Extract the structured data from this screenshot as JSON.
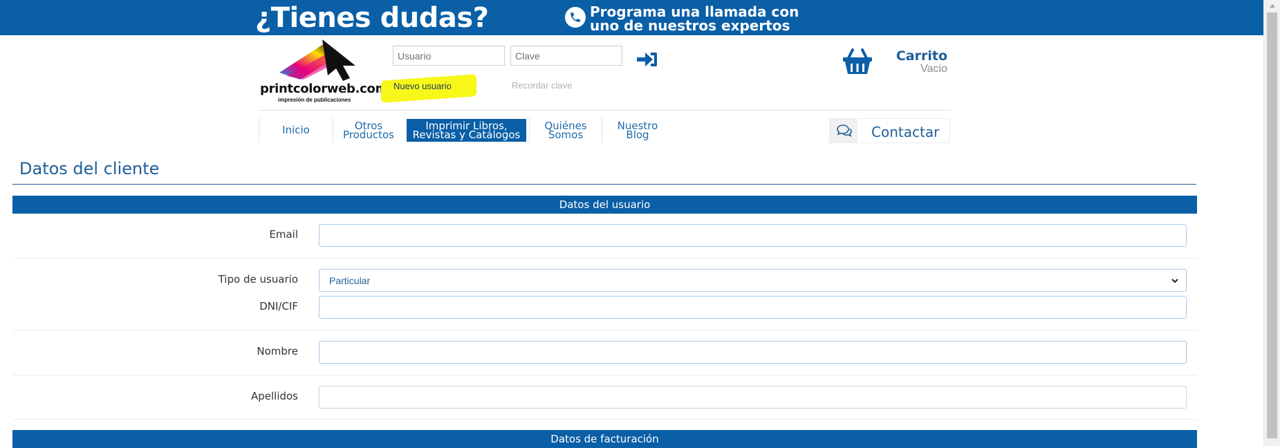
{
  "banner": {
    "question": "¿Tienes dudas?",
    "call_line1": "Programa una llamada con",
    "call_line2": "uno de nuestros expertos",
    "phone_icon": "phone-icon",
    "color": "#0a5fa6"
  },
  "header": {
    "logo_text": "printcolorweb.com",
    "logo_sub": "impresión de publicaciones",
    "user_placeholder": "Usuario",
    "pass_placeholder": "Clave",
    "login_icon": "sign-in-icon",
    "new_user": "Nuevo usuario",
    "remember": "Recordar clave",
    "cart": {
      "title": "Carrito",
      "status": "Vacio",
      "icon": "basket-icon"
    }
  },
  "nav": {
    "items": [
      {
        "line1": "Inicio",
        "line2": ""
      },
      {
        "line1": "Otros",
        "line2": "Productos"
      },
      {
        "line1": "Imprimir Libros,",
        "line2": "Revistas y Catálogos"
      },
      {
        "line1": "Quiénes",
        "line2": "Somos"
      },
      {
        "line1": "Nuestro",
        "line2": "Blog"
      }
    ],
    "active_index": 2,
    "contact": {
      "label": "Contactar",
      "icon": "chat-icon"
    }
  },
  "page": {
    "title": "Datos del cliente",
    "sections": {
      "user": "Datos del usuario",
      "billing": "Datos de facturación"
    },
    "form": {
      "email_label": "Email",
      "email_value": "",
      "user_type_label": "Tipo de usuario",
      "user_type_value": "Particular",
      "dni_label": "DNI/CIF",
      "dni_value": "",
      "name_label": "Nombre",
      "name_value": "",
      "surname_label": "Apellidos",
      "surname_value": ""
    }
  },
  "colors": {
    "accent": "#0a5fa6",
    "text_blue": "#1f5f99",
    "highlight": "#f7f71a"
  }
}
